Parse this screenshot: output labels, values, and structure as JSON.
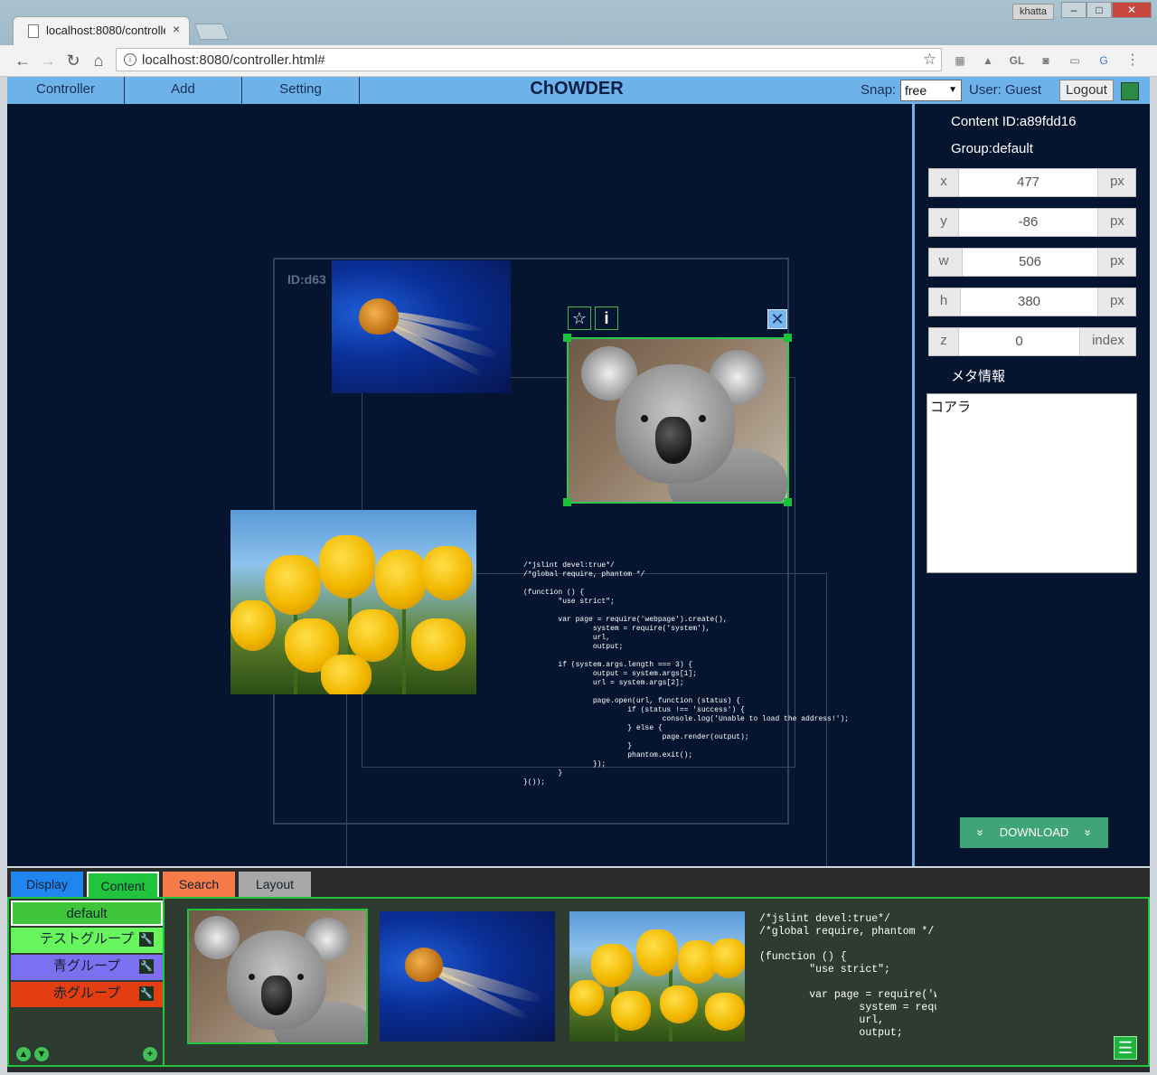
{
  "browser": {
    "tab_title": "localhost:8080/controller.html#",
    "url": "localhost:8080/controller.html#",
    "profile": "khatta",
    "window_buttons": [
      "–",
      "□",
      "✕"
    ],
    "extensions": [
      "▦",
      "▲",
      "GL",
      "◙",
      "▭",
      "G"
    ]
  },
  "app": {
    "menu": [
      "Controller",
      "Add",
      "Setting"
    ],
    "title": "ChOWDER",
    "snap_label": "Snap:",
    "snap_value": "free",
    "user_label": "User: Guest",
    "logout_label": "Logout"
  },
  "stage": {
    "display_id": "ID:d63",
    "selection_buttons": {
      "star": "☆",
      "info": "i",
      "close": "✕"
    }
  },
  "code_lines": [
    "/*jslint devel:true*/",
    "/*global require, phantom */",
    "",
    "(function () {",
    "        \"use strict\";",
    "",
    "        var page = require('webpage').create(),",
    "                system = require('system'),",
    "                url,",
    "                output;",
    "",
    "        if (system.args.length === 3) {",
    "                output = system.args[1];",
    "                url = system.args[2];",
    "",
    "                page.open(url, function (status) {",
    "                        if (status !== 'success') {",
    "                                console.log('Unable to load the address!');",
    "                        } else {",
    "                                page.render(output);",
    "                        }",
    "                        phantom.exit();",
    "                });",
    "        }",
    "}());"
  ],
  "properties": {
    "content_id": "Content ID:a89fdd16",
    "group": "Group:default",
    "fields": [
      {
        "label": "x",
        "value": "477",
        "unit": "px"
      },
      {
        "label": "y",
        "value": "-86",
        "unit": "px"
      },
      {
        "label": "w",
        "value": "506",
        "unit": "px"
      },
      {
        "label": "h",
        "value": "380",
        "unit": "px"
      },
      {
        "label": "z",
        "value": "0",
        "unit": "index"
      }
    ],
    "meta_label": "メタ情報",
    "meta_value": "コアラ",
    "download_label": "DOWNLOAD",
    "download_icon": "»"
  },
  "bottom": {
    "tabs": [
      {
        "label": "Display",
        "color": "#1f86f0"
      },
      {
        "label": "Content",
        "color": "#21c43c"
      },
      {
        "label": "Search",
        "color": "#f57b4a"
      },
      {
        "label": "Layout",
        "color": "#a8a8a8"
      }
    ],
    "groups": [
      {
        "label": "default",
        "color": "#3ec53a"
      },
      {
        "label": "テストグループ",
        "color": "#66f55c"
      },
      {
        "label": "青グループ",
        "color": "#7c6ff0"
      },
      {
        "label": "赤グループ",
        "color": "#e23e12"
      }
    ],
    "group_icons": {
      "up": "▲",
      "down": "▼",
      "add": "+",
      "wrench": "🔧"
    },
    "thumbnail_code_lines": [
      "/*jslint devel:true*/",
      "/*global require, phantom */",
      "",
      "(function () {",
      "        \"use strict\";",
      "",
      "        var page = require('webpage",
      "                system = require('sys",
      "                url,",
      "                output;"
    ],
    "menu_icon": "☰"
  }
}
